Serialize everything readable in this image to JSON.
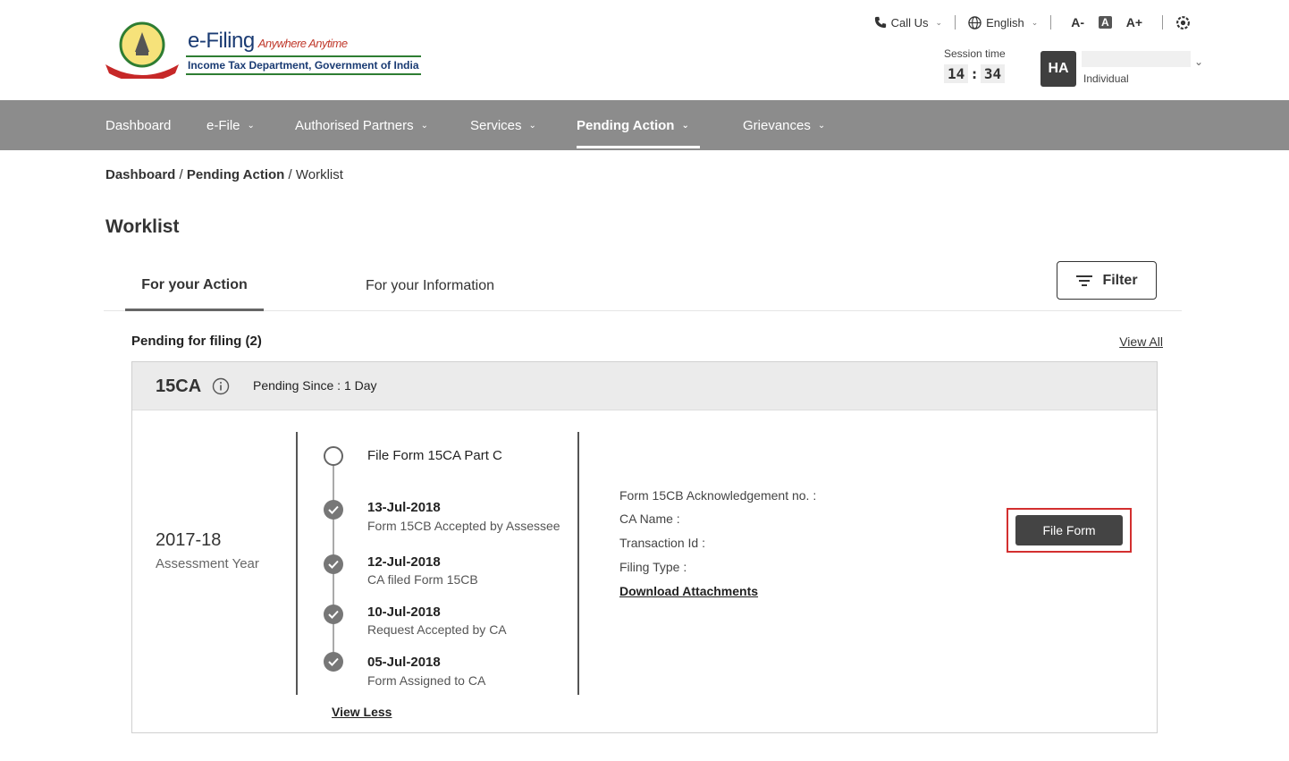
{
  "header": {
    "logo_title": "e-Filing",
    "logo_tagline": "Anywhere Anytime",
    "logo_subtitle": "Income Tax Department, Government of India",
    "call_us": "Call Us",
    "language": "English",
    "font_decrease": "A-",
    "font_normal": "A",
    "font_increase": "A+",
    "session_label": "Session time",
    "session_hh": "14",
    "session_mm": "34",
    "avatar_initials": "HA",
    "user_type": "Individual"
  },
  "nav": {
    "items": [
      {
        "label": "Dashboard"
      },
      {
        "label": "e-File"
      },
      {
        "label": "Authorised Partners"
      },
      {
        "label": "Services"
      },
      {
        "label": "Pending Action"
      },
      {
        "label": "Grievances"
      }
    ]
  },
  "breadcrumb": {
    "dashboard": "Dashboard",
    "pending": "Pending Action",
    "current": "Worklist",
    "sep": "/"
  },
  "page_title": "Worklist",
  "tabs": {
    "action": "For your Action",
    "information": "For your Information",
    "filter": "Filter"
  },
  "pending": {
    "title": "Pending for filing (2)",
    "view_all": "View All"
  },
  "card": {
    "form_code": "15CA",
    "pending_since": "Pending Since : 1 Day",
    "assessment_year": "2017-18",
    "assessment_label": "Assessment Year",
    "timeline": [
      {
        "date": "",
        "desc": "File Form 15CA Part C"
      },
      {
        "date": "13-Jul-2018",
        "desc": "Form 15CB Accepted by Assessee"
      },
      {
        "date": "12-Jul-2018",
        "desc": "CA filed Form 15CB"
      },
      {
        "date": "10-Jul-2018",
        "desc": "Request Accepted by CA"
      },
      {
        "date": "05-Jul-2018",
        "desc": "Form Assigned to CA"
      }
    ],
    "view_less": "View Less",
    "details": {
      "ack": "Form 15CB Acknowledgement no. :",
      "ca_name": "CA Name :",
      "txn_id": "Transaction Id :",
      "filing_type": "Filing Type :",
      "download": "Download Attachments"
    },
    "file_form": "File Form"
  }
}
